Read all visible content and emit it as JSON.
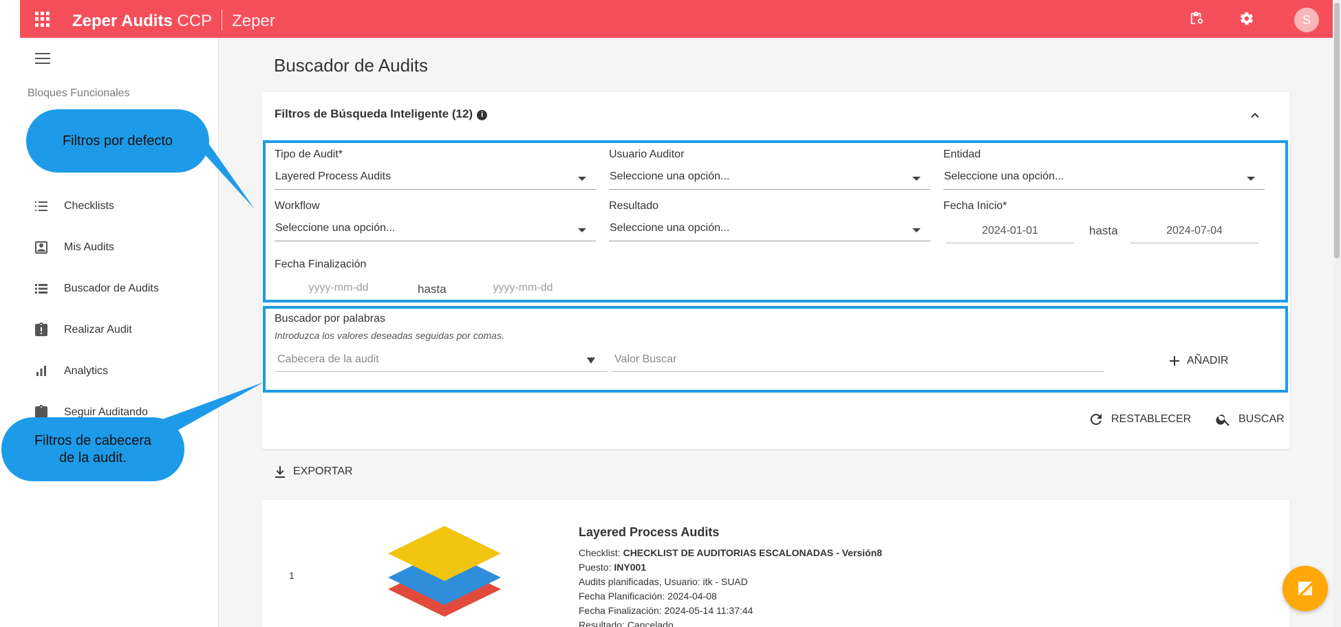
{
  "header": {
    "brand_bold": "Zeper Audits",
    "brand_suffix": "CCP",
    "company": "Zeper",
    "avatar_initial": "S",
    "color": "#f54e5b"
  },
  "sidebar": {
    "section_title": "Bloques Funcionales",
    "items": [
      {
        "label": "Checklists",
        "icon": "list-icon"
      },
      {
        "label": "Mis Audits",
        "icon": "account-box-icon"
      },
      {
        "label": "Buscador de Audits",
        "icon": "view-list-icon"
      },
      {
        "label": "Realizar Audit",
        "icon": "clipboard-alert-icon"
      },
      {
        "label": "Analytics",
        "icon": "bar-chart-icon"
      },
      {
        "label": "Seguir Auditando",
        "icon": "clipboard-icon"
      }
    ]
  },
  "main": {
    "page_title": "Buscador de Audits",
    "filters": {
      "title": "Filtros de Búsqueda Inteligente (12)",
      "info": "i",
      "tipo_label": "Tipo de Audit*",
      "tipo_value": "Layered Process Audits",
      "usuario_label": "Usuario Auditor",
      "usuario_value": "Seleccione una opción...",
      "entidad_label": "Entidad",
      "entidad_value": "Seleccione una opción...",
      "workflow_label": "Workflow",
      "workflow_value": "Seleccione una opción...",
      "resultado_label": "Resultado",
      "resultado_value": "Seleccione una opción...",
      "fecha_inicio_label": "Fecha Inicio*",
      "fecha_inicio_from": "2024-01-01",
      "fecha_inicio_to": "2024-07-04",
      "hasta": "hasta",
      "fecha_fin_label": "Fecha Finalización",
      "fecha_fin_from_ph": "yyyy-mm-dd",
      "fecha_fin_to_ph": "yyyy-mm-dd"
    },
    "keywords": {
      "title": "Buscador por palabras",
      "hint": "Introduzca los valores deseadas seguidas por comas.",
      "cabecera_ph": "Cabecera de la audit",
      "valor_ph": "Valor Buscar",
      "add_label": "AÑADIR"
    },
    "actions": {
      "reset_label": "RESTABLECER",
      "search_label": "BUSCAR"
    },
    "export_label": "EXPORTAR",
    "result": {
      "index": "1",
      "title": "Layered Process Audits",
      "checklist_label": "Checklist:",
      "checklist_value": "CHECKLIST DE AUDITORIAS ESCALONADAS - Versión8",
      "puesto_label": "Puesto:",
      "puesto_value": "INY001",
      "planned": "Audits planificadas, Usuario: itk - SUAD",
      "fecha_plan": "Fecha Planificación: 2024-04-08",
      "fecha_fin": "Fecha Finalización: 2024-05-14 11:37:44",
      "resultado": "Resultado: Cancelado"
    }
  },
  "callouts": {
    "defaults": "Filtros por defecto",
    "header_line1": "Filtros de cabecera",
    "header_line2": "de la audit.",
    "color": "#1e9be8"
  }
}
